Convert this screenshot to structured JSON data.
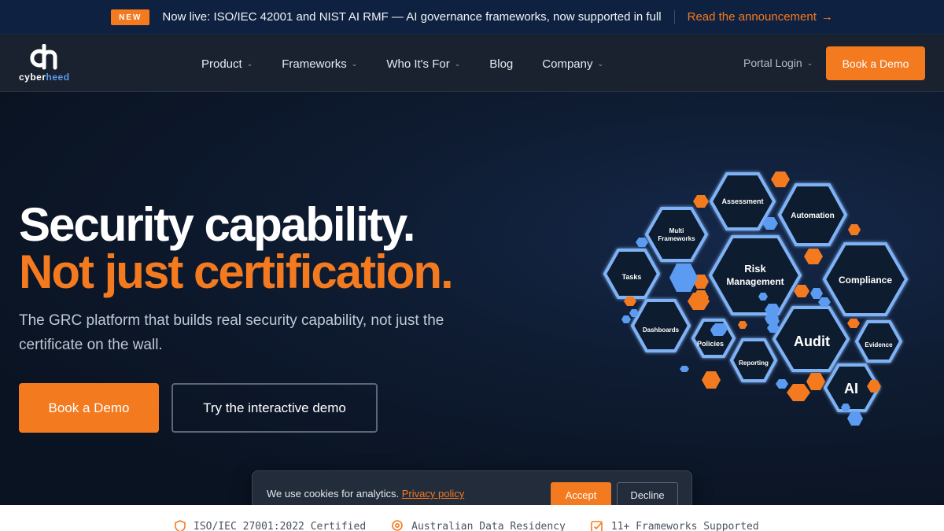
{
  "announcement": {
    "badge": "NEW",
    "text": "Now live: ISO/IEC 42001 and NIST AI RMF — AI governance frameworks, now supported in full",
    "link_label": "Read the announcement",
    "link_icon": "arrow-right-icon"
  },
  "brand": {
    "logo_word_a": "cyber",
    "logo_word_b": "heed",
    "accent": "#f47a20",
    "secondary": "#5b9cf2"
  },
  "nav": {
    "items": [
      {
        "label": "Product",
        "dropdown": true
      },
      {
        "label": "Frameworks",
        "dropdown": true
      },
      {
        "label": "Who It's For",
        "dropdown": true
      },
      {
        "label": "Blog",
        "dropdown": false
      },
      {
        "label": "Company",
        "dropdown": true
      }
    ],
    "portal_login": "Portal Login",
    "cta": "Book a Demo"
  },
  "hero": {
    "headline_1": "Security capability.",
    "headline_2": "Not just certification.",
    "subtitle": "The GRC platform that builds real security capability, not just the certificate on the wall.",
    "primary_cta": "Book a Demo",
    "secondary_cta": "Try the interactive demo"
  },
  "hex_labels": {
    "assessment": "Assessment",
    "automation": "Automation",
    "multi_1": "Multi",
    "multi_2": "Frameworks",
    "risk_1": "Risk",
    "risk_2": "Management",
    "tasks": "Tasks",
    "compliance": "Compliance",
    "dashboards": "Dashboards",
    "policies": "Policies",
    "audit": "Audit",
    "evidence": "Evidence",
    "reporting": "Reporting",
    "ai": "AI"
  },
  "cookie": {
    "text": "We use cookies for analytics.",
    "link": "Privacy policy",
    "accept": "Accept",
    "decline": "Decline"
  },
  "trust": [
    {
      "icon": "shield-icon",
      "label": "ISO/IEC 27001:2022 Certified"
    },
    {
      "icon": "location-pin-icon",
      "label": "Australian Data Residency"
    },
    {
      "icon": "checkbox-icon",
      "label": "11+ Frameworks Supported"
    }
  ]
}
